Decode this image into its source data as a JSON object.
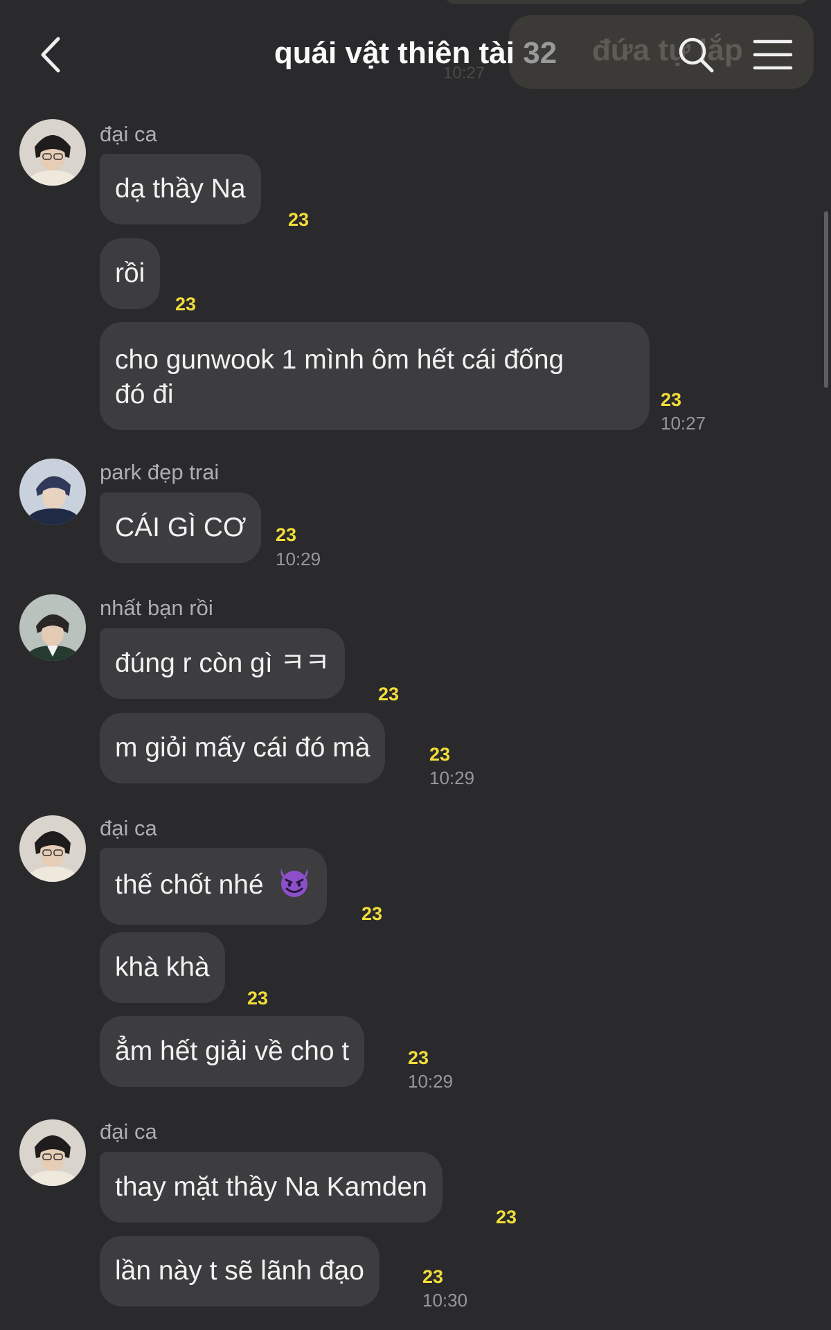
{
  "header": {
    "title": "quái vật thiên tài",
    "member_count": "32",
    "background_preview_text": "đứa tự lắp",
    "background_preview_time": "10:27",
    "icons": [
      "back-chevron-icon",
      "search-icon",
      "menu-icon"
    ]
  },
  "colors": {
    "background": "#2a2a2c",
    "bubble": "#3d3d40",
    "unread": "#f2dd3a",
    "time": "#98989a"
  },
  "messages": [
    {
      "sender": "đại ca",
      "text": "dạ thầy Na",
      "unread": "23"
    },
    {
      "text": "rồi",
      "unread": "23"
    },
    {
      "text_line1": "cho gunwook 1 mình ôm hết cái đống",
      "text_line2": "đó đi",
      "unread": "23",
      "time": "10:27"
    },
    {
      "sender": "park đẹp trai",
      "text": "CÁI GÌ CƠ",
      "unread": "23",
      "time": "10:29"
    },
    {
      "sender": "nhất bạn rồi",
      "text": "đúng r còn gì ㅋㅋ",
      "unread": "23"
    },
    {
      "text": "m giỏi mấy cái đó mà",
      "unread": "23",
      "time": "10:29"
    },
    {
      "sender": "đại ca",
      "text": "thế chốt nhé",
      "emoji": "😈",
      "unread": "23"
    },
    {
      "text": "khà khà",
      "unread": "23"
    },
    {
      "text": "ẳm hết giải về cho t",
      "unread": "23",
      "time": "10:29"
    },
    {
      "sender": "đại ca",
      "text": "thay mặt thầy Na Kamden",
      "unread": "23"
    },
    {
      "text": "lần này t sẽ lãnh đạo",
      "unread": "23",
      "time": "10:30"
    }
  ]
}
